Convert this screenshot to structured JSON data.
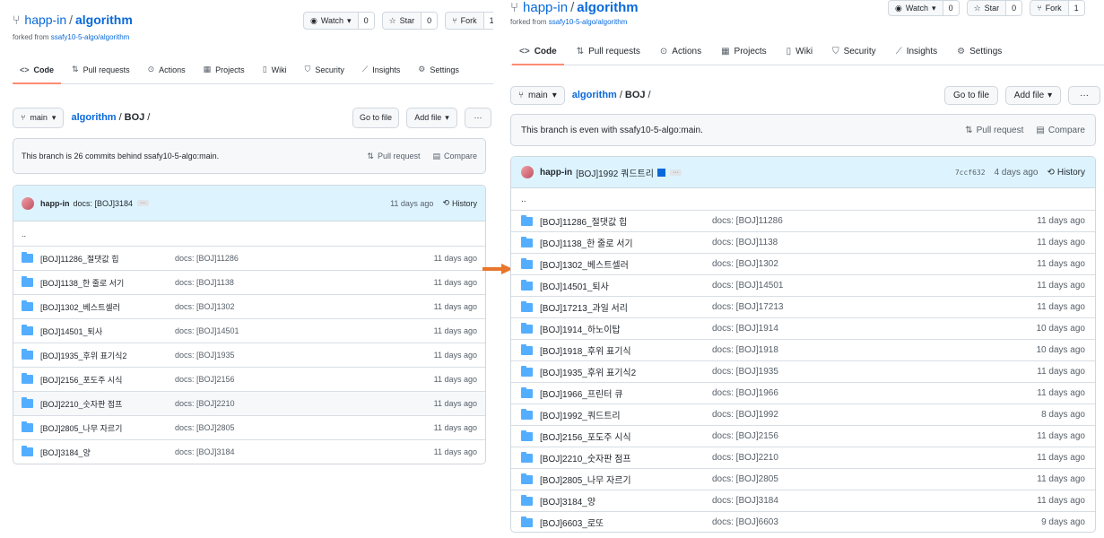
{
  "left": {
    "owner": "happ-in",
    "repo": "algorithm",
    "forked_prefix": "forked from",
    "forked_source": "ssafy10-5-algo/algorithm",
    "watch": {
      "label": "Watch",
      "count": "0"
    },
    "star": {
      "label": "Star",
      "count": "0"
    },
    "fork": {
      "label": "Fork",
      "count": "1"
    },
    "tabs": [
      "Code",
      "Pull requests",
      "Actions",
      "Projects",
      "Wiki",
      "Security",
      "Insights",
      "Settings"
    ],
    "branch": "main",
    "crumb_repo": "algorithm",
    "crumb_dir": "BOJ",
    "goto_file": "Go to file",
    "add_file": "Add file",
    "branch_status": "This branch is 26 commits behind ssafy10-5-algo:main.",
    "pull_request": "Pull request",
    "compare": "Compare",
    "commit": {
      "author": "happ-in",
      "message": "docs: [BOJ]3184",
      "time": "11 days ago",
      "history": "History"
    },
    "parent": "..",
    "files": [
      {
        "name": "[BOJ]11286_절댓값 힙",
        "msg": "docs: [BOJ]11286",
        "date": "11 days ago"
      },
      {
        "name": "[BOJ]1138_한 줄로 서기",
        "msg": "docs: [BOJ]1138",
        "date": "11 days ago"
      },
      {
        "name": "[BOJ]1302_베스트셀러",
        "msg": "docs: [BOJ]1302",
        "date": "11 days ago"
      },
      {
        "name": "[BOJ]14501_퇴사",
        "msg": "docs: [BOJ]14501",
        "date": "11 days ago"
      },
      {
        "name": "[BOJ]1935_후위 표기식2",
        "msg": "docs: [BOJ]1935",
        "date": "11 days ago"
      },
      {
        "name": "[BOJ]2156_포도주 시식",
        "msg": "docs: [BOJ]2156",
        "date": "11 days ago"
      },
      {
        "name": "[BOJ]2210_숫자판 점프",
        "msg": "docs: [BOJ]2210",
        "date": "11 days ago"
      },
      {
        "name": "[BOJ]2805_나무 자르기",
        "msg": "docs: [BOJ]2805",
        "date": "11 days ago"
      },
      {
        "name": "[BOJ]3184_양",
        "msg": "docs: [BOJ]3184",
        "date": "11 days ago"
      }
    ]
  },
  "right": {
    "owner": "happ-in",
    "repo": "algorithm",
    "forked_prefix": "forked from",
    "forked_source": "ssafy10-5-algo/algorithm",
    "watch": {
      "label": "Watch",
      "count": "0"
    },
    "star": {
      "label": "Star",
      "count": "0"
    },
    "fork": {
      "label": "Fork",
      "count": "1"
    },
    "tabs": [
      "Code",
      "Pull requests",
      "Actions",
      "Projects",
      "Wiki",
      "Security",
      "Insights",
      "Settings"
    ],
    "branch": "main",
    "crumb_repo": "algorithm",
    "crumb_dir": "BOJ",
    "goto_file": "Go to file",
    "add_file": "Add file",
    "branch_status": "This branch is even with ssafy10-5-algo:main.",
    "pull_request": "Pull request",
    "compare": "Compare",
    "commit": {
      "author": "happ-in",
      "message": "[BOJ]1992 쿼드트리",
      "sha": "7ccf632",
      "time": "4 days ago",
      "history": "History"
    },
    "parent": "..",
    "files": [
      {
        "name": "[BOJ]11286_절댓값 힙",
        "msg": "docs: [BOJ]11286",
        "date": "11 days ago"
      },
      {
        "name": "[BOJ]1138_한 줄로 서기",
        "msg": "docs: [BOJ]1138",
        "date": "11 days ago"
      },
      {
        "name": "[BOJ]1302_베스트셀러",
        "msg": "docs: [BOJ]1302",
        "date": "11 days ago"
      },
      {
        "name": "[BOJ]14501_퇴사",
        "msg": "docs: [BOJ]14501",
        "date": "11 days ago"
      },
      {
        "name": "[BOJ]17213_과일 서리",
        "msg": "docs: [BOJ]17213",
        "date": "11 days ago"
      },
      {
        "name": "[BOJ]1914_하노이탑",
        "msg": "docs: [BOJ]1914",
        "date": "10 days ago"
      },
      {
        "name": "[BOJ]1918_후위 표기식",
        "msg": "docs: [BOJ]1918",
        "date": "10 days ago"
      },
      {
        "name": "[BOJ]1935_후위 표기식2",
        "msg": "docs: [BOJ]1935",
        "date": "11 days ago"
      },
      {
        "name": "[BOJ]1966_프린터 큐",
        "msg": "docs: [BOJ]1966",
        "date": "11 days ago"
      },
      {
        "name": "[BOJ]1992_쿼드트리",
        "msg": "docs: [BOJ]1992",
        "date": "8 days ago"
      },
      {
        "name": "[BOJ]2156_포도주 시식",
        "msg": "docs: [BOJ]2156",
        "date": "11 days ago"
      },
      {
        "name": "[BOJ]2210_숫자판 점프",
        "msg": "docs: [BOJ]2210",
        "date": "11 days ago"
      },
      {
        "name": "[BOJ]2805_나무 자르기",
        "msg": "docs: [BOJ]2805",
        "date": "11 days ago"
      },
      {
        "name": "[BOJ]3184_양",
        "msg": "docs: [BOJ]3184",
        "date": "11 days ago"
      },
      {
        "name": "[BOJ]6603_로또",
        "msg": "docs: [BOJ]6603",
        "date": "9 days ago"
      }
    ]
  },
  "colors": {
    "link": "#0969da",
    "tab_underline": "#fd8c73",
    "folder": "#54aeff",
    "arrow": "#e8762b"
  }
}
